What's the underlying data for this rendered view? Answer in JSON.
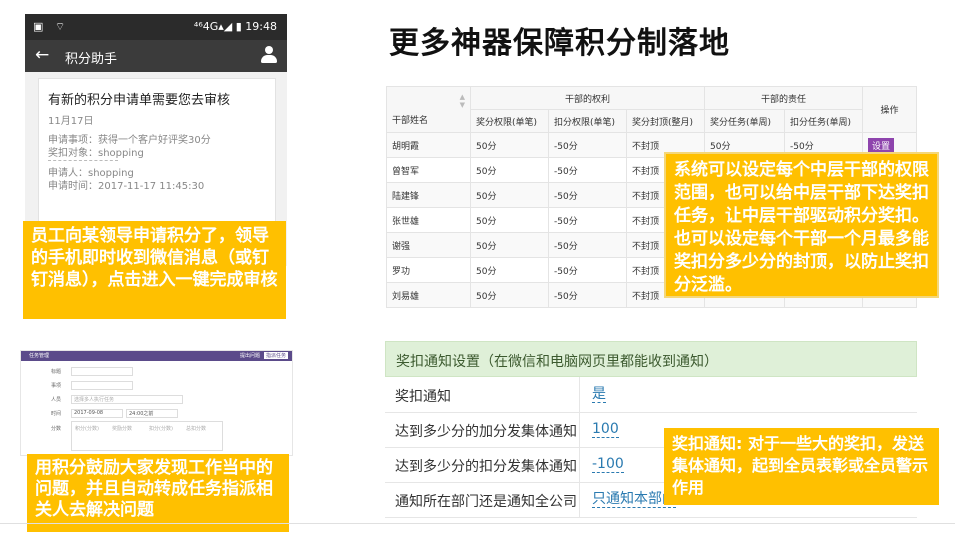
{
  "heading": "更多神器保障积分制落地",
  "phone": {
    "status_left": "▣ ⌔",
    "status_right": "⁴⁶4G▴◢ ▮ 19:48",
    "app_title": "积分助手",
    "card_title": "有新的积分申请单需要您去审核",
    "card_date": "11月17日",
    "apply_item": "申请事项：获得一个客户好评奖30分",
    "award_target": "奖扣对象：shopping",
    "applicant": "申请人：shopping",
    "apply_time": "申请时间：2017-11-17 11:45:30"
  },
  "callouts": {
    "c1": "员工向某领导申请积分了，领导的手机即时收到微信消息（或钉钉消息），点击进入一键完成审核",
    "c2": "系统可以设定每个中层干部的权限范围，也可以给中层干部下达奖扣任务，让中层干部驱动积分奖扣。也可以设定每个干部一个月最多能奖扣分多少分的封顶，以防止奖扣分泛滥。",
    "c3": "用积分鼓励大家发现工作当中的问题，并且自动转成任务指派相关人去解决问题",
    "c4": "奖扣通知: 对于一些大的奖扣，发送集体通知，起到全员表彰或全员警示作用"
  },
  "table": {
    "col_name": "干部姓名",
    "group_rights": "干部的权利",
    "group_duty": "干部的责任",
    "col_op": "操作",
    "sub_headers": [
      "奖分权限(单笔)",
      "扣分权限(单笔)",
      "奖分封顶(整月)",
      "奖分任务(单周)",
      "扣分任务(单周)"
    ],
    "setting_label": "设置",
    "rows": [
      [
        "胡明霞",
        "50分",
        "-50分",
        "不封顶",
        "50分",
        "-50分"
      ],
      [
        "曾智军",
        "50分",
        "-50分",
        "不封顶",
        "",
        ""
      ],
      [
        "陆建锋",
        "50分",
        "-50分",
        "不封顶",
        "",
        ""
      ],
      [
        "张世雄",
        "50分",
        "-50分",
        "不封顶",
        "",
        ""
      ],
      [
        "谢强",
        "50分",
        "-50分",
        "不封顶",
        "",
        ""
      ],
      [
        "罗功",
        "50分",
        "-50分",
        "不封顶",
        "",
        ""
      ],
      [
        "刘易雄",
        "50分",
        "-50分",
        "不封顶",
        "",
        ""
      ]
    ]
  },
  "thumb": {
    "title": "任务管理",
    "tabs": [
      "提出问题",
      "指派任务"
    ],
    "labels": [
      "标题",
      "事项",
      "人员",
      "时间",
      "分数"
    ],
    "placeholder_people": "选择多人执行任务",
    "date_value": "2017-09-08",
    "time_value": "24:00之前",
    "scores": [
      "积分(分数)",
      "奖励分数",
      "扣分(分数)",
      "总扣分数"
    ]
  },
  "notify": {
    "header": "奖扣通知设置（在微信和电脑网页里都能收到通知）",
    "rows": [
      {
        "label": "奖扣通知",
        "value": "是"
      },
      {
        "label": "达到多少分的加分发集体通知",
        "value": "100"
      },
      {
        "label": "达到多少分的扣分发集体通知",
        "value": "-100"
      },
      {
        "label": "通知所在部门还是通知全公司",
        "value": "只通知本部门"
      }
    ]
  }
}
